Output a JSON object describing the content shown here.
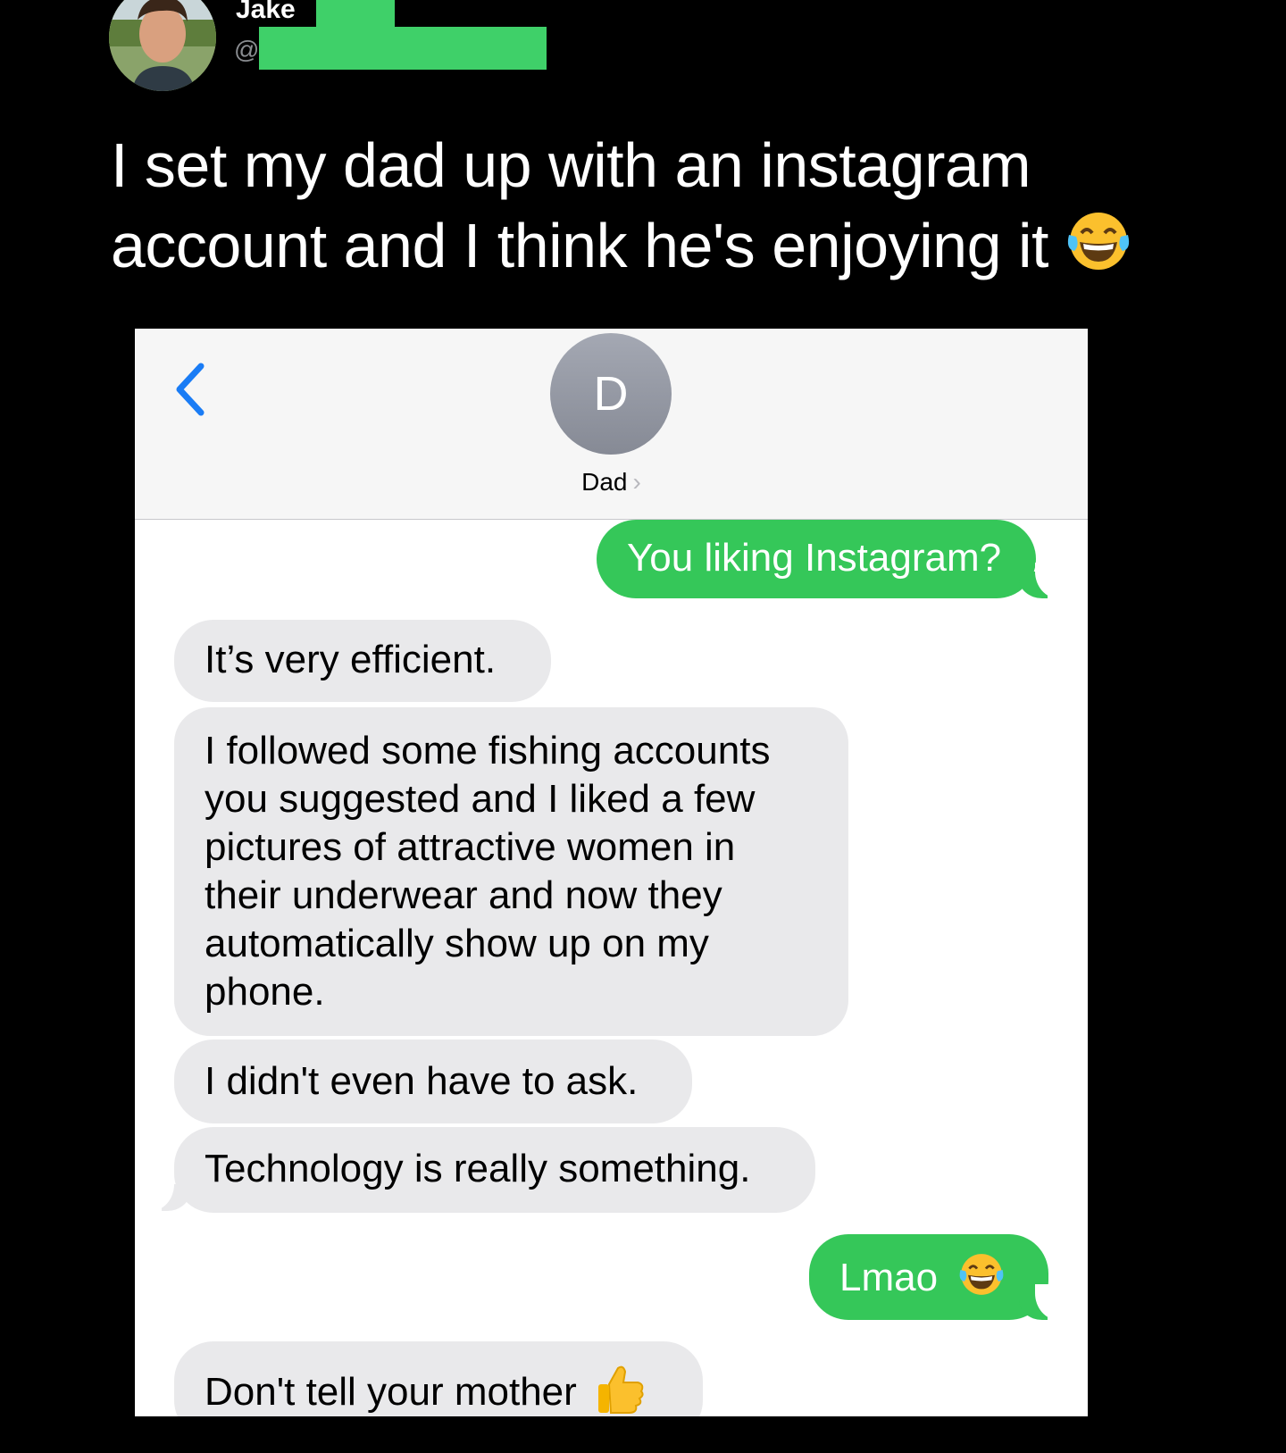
{
  "tweet": {
    "author_name": "Jake",
    "handle_prefix": "@",
    "text": "I set my dad up with an instagram account and I think he's enjoying it",
    "emoji_icon": "face-with-tears-of-joy-icon",
    "redaction_color": "#3fd069"
  },
  "conversation": {
    "contact_initial": "D",
    "contact_name": "Dad",
    "contact_chevron": "›",
    "back_icon": "chevron-left-icon",
    "accent_color": "#1a7cf5",
    "sent_color": "#35c759",
    "received_color": "#e9e9eb",
    "messages": [
      {
        "direction": "sent",
        "text": "You liking Instagram?"
      },
      {
        "direction": "received",
        "text": "It’s very efficient."
      },
      {
        "direction": "received",
        "text": "I followed some fishing accounts you suggested and I liked a few pictures of attractive women in their underwear and now they automatically show up on my phone."
      },
      {
        "direction": "received",
        "text": "I didn't even have to ask."
      },
      {
        "direction": "received",
        "text": "Technology is really something."
      },
      {
        "direction": "sent",
        "text": "Lmao",
        "emoji_icon": "face-with-tears-of-joy-icon"
      },
      {
        "direction": "received",
        "text": "Don't tell your mother",
        "emoji_icon": "thumbs-up-icon"
      }
    ]
  }
}
